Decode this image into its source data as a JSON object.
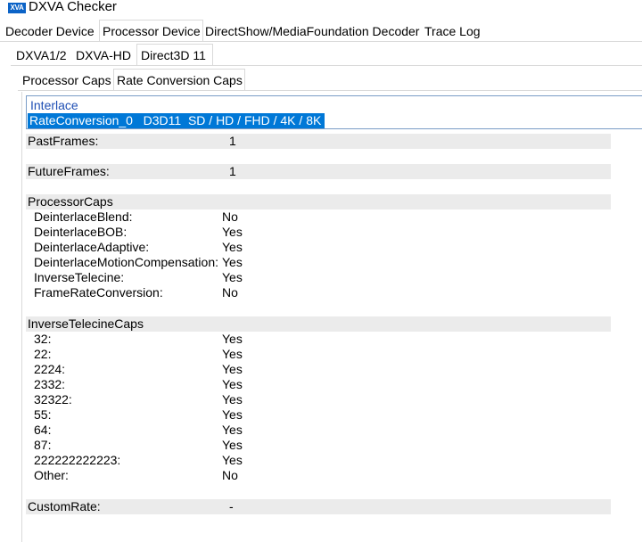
{
  "window": {
    "icon_text": "XVA",
    "title": "DXVA Checker"
  },
  "main_tabs": [
    {
      "label": "Decoder Device",
      "active": false
    },
    {
      "label": "Processor Device",
      "active": true
    },
    {
      "label": "DirectShow/MediaFoundation Decoder",
      "active": false
    },
    {
      "label": "Trace Log",
      "active": false
    }
  ],
  "sub_tabs": [
    {
      "label": "DXVA1/2",
      "active": false
    },
    {
      "label": "DXVA-HD",
      "active": false
    },
    {
      "label": "Direct3D 11",
      "active": true
    }
  ],
  "caps_tabs": [
    {
      "label": "Processor Caps",
      "active": false
    },
    {
      "label": "Rate Conversion Caps",
      "active": true
    }
  ],
  "selector": {
    "group": "Interlace",
    "selected": "RateConversion_0   D3D11  SD / HD / FHD / 4K / 8K"
  },
  "properties": {
    "past_frames": {
      "label": "PastFrames:",
      "value": "1"
    },
    "future_frames": {
      "label": "FutureFrames:",
      "value": "1"
    },
    "processor_caps": {
      "title": "ProcessorCaps",
      "items": [
        {
          "label": "DeinterlaceBlend:",
          "value": "No"
        },
        {
          "label": "DeinterlaceBOB:",
          "value": "Yes"
        },
        {
          "label": "DeinterlaceAdaptive:",
          "value": "Yes"
        },
        {
          "label": "DeinterlaceMotionCompensation:",
          "value": "Yes"
        },
        {
          "label": "InverseTelecine:",
          "value": "Yes"
        },
        {
          "label": "FrameRateConversion:",
          "value": "No"
        }
      ]
    },
    "inverse_telecine_caps": {
      "title": "InverseTelecineCaps",
      "items": [
        {
          "label": "32:",
          "value": "Yes"
        },
        {
          "label": "22:",
          "value": "Yes"
        },
        {
          "label": "2224:",
          "value": "Yes"
        },
        {
          "label": "2332:",
          "value": "Yes"
        },
        {
          "label": "32322:",
          "value": "Yes"
        },
        {
          "label": "55:",
          "value": "Yes"
        },
        {
          "label": "64:",
          "value": "Yes"
        },
        {
          "label": "87:",
          "value": "Yes"
        },
        {
          "label": "222222222223:",
          "value": "Yes"
        },
        {
          "label": "Other:",
          "value": "No"
        }
      ]
    },
    "custom_rate": {
      "label": "CustomRate:",
      "value": "-"
    }
  }
}
